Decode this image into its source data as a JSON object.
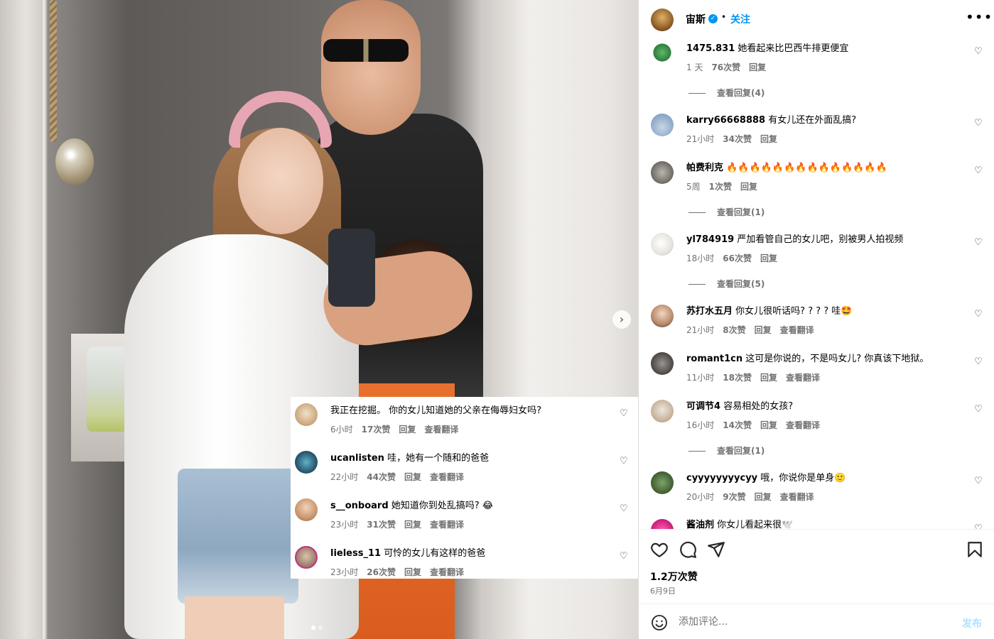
{
  "post_header": {
    "username": "宙斯",
    "separator": "•",
    "follow_label": "关注",
    "more_label": "•••"
  },
  "carousel": {
    "next_label": "›",
    "current_slide": 1,
    "slide_count": 2
  },
  "overlay_comments": [
    {
      "user": "",
      "text": "我正在挖掘。 你的女儿知道她的父亲在侮辱妇女吗?",
      "time": "6小时",
      "likes": "17次赞",
      "reply": "回复",
      "translate": "查看翻译"
    },
    {
      "user": "ucanlisten",
      "text": "哇，她有一个随和的爸爸",
      "time": "22小时",
      "likes": "44次赞",
      "reply": "回复",
      "translate": "查看翻译"
    },
    {
      "user": "s__onboard",
      "text": "她知道你到处乱搞吗? 😂",
      "time": "23小时",
      "likes": "31次赞",
      "reply": "回复",
      "translate": "查看翻译"
    },
    {
      "user": "lieless_11",
      "text": "可怜的女儿有这样的爸爸",
      "time": "23小时",
      "likes": "26次赞",
      "reply": "回复",
      "translate": "查看翻译"
    }
  ],
  "comments": [
    {
      "user": "1475.831",
      "text": "她看起来比巴西牛排更便宜",
      "time": "1 天",
      "likes": "76次赞",
      "reply": "回复",
      "translate": "",
      "view_replies": "查看回复(4)"
    },
    {
      "user": "karry66668888",
      "text": "有女儿还在外面乱搞?",
      "time": "21小时",
      "likes": "34次赞",
      "reply": "回复",
      "translate": "",
      "view_replies": ""
    },
    {
      "user": "帕费利克",
      "text": "🔥🔥🔥🔥🔥🔥🔥🔥🔥🔥🔥🔥🔥🔥",
      "time": "5周",
      "likes": "1次赞",
      "reply": "回复",
      "translate": "",
      "view_replies": "查看回复(1)"
    },
    {
      "user": "yl784919",
      "text": "严加看管自己的女儿吧，别被男人拍视频",
      "time": "18小时",
      "likes": "66次赞",
      "reply": "回复",
      "translate": "",
      "view_replies": "查看回复(5)"
    },
    {
      "user": "苏打水五月",
      "text": "你女儿很听话吗? ? ? ? 哇🤩",
      "time": "21小时",
      "likes": "8次赞",
      "reply": "回复",
      "translate": "查看翻译",
      "view_replies": ""
    },
    {
      "user": "romant1cn",
      "text": "这可是你说的，不是吗女儿? 你真该下地狱。",
      "time": "11小时",
      "likes": "18次赞",
      "reply": "回复",
      "translate": "查看翻译",
      "view_replies": ""
    },
    {
      "user": "可调节4",
      "text": "容易相处的女孩?",
      "time": "16小时",
      "likes": "14次赞",
      "reply": "回复",
      "translate": "查看翻译",
      "view_replies": "查看回复(1)"
    },
    {
      "user": "cyyyyyyyycyy",
      "text": "哦，你说你是单身🙂",
      "time": "20小时",
      "likes": "9次赞",
      "reply": "回复",
      "translate": "查看翻译",
      "view_replies": ""
    },
    {
      "user": "酱油剂",
      "text": "你女儿看起来很🕊️",
      "time": "",
      "likes": "",
      "reply": "",
      "translate": "",
      "view_replies": ""
    }
  ],
  "actions": {
    "likes_count": "1.2万次赞",
    "date": "6月9日"
  },
  "comment_box": {
    "placeholder": "添加评论...",
    "post_label": "发布"
  },
  "icons": {
    "like": "heart-icon",
    "comment": "comment-icon",
    "share": "send-icon",
    "save": "bookmark-icon",
    "emoji": "emoji-icon"
  }
}
